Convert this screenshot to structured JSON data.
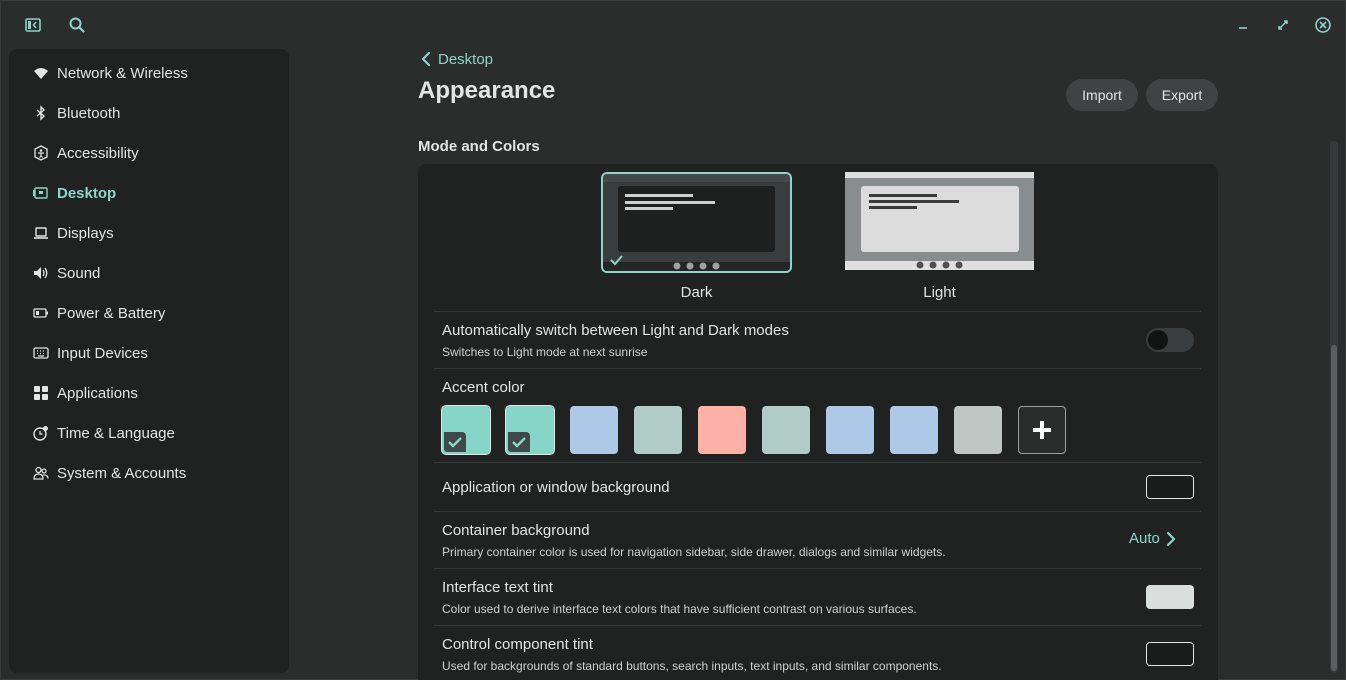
{
  "header": {
    "sidebar_toggle_icon": "sidebar-toggle-icon",
    "search_icon": "search-icon",
    "minimize_icon": "minimize-icon",
    "maximize_icon": "maximize-icon",
    "close_icon": "close-icon"
  },
  "sidebar": {
    "items": [
      {
        "label": "Network & Wireless",
        "icon": "wifi-icon"
      },
      {
        "label": "Bluetooth",
        "icon": "bluetooth-icon"
      },
      {
        "label": "Accessibility",
        "icon": "accessibility-icon"
      },
      {
        "label": "Desktop",
        "icon": "desktop-icon"
      },
      {
        "label": "Displays",
        "icon": "laptop-icon"
      },
      {
        "label": "Sound",
        "icon": "speaker-icon"
      },
      {
        "label": "Power & Battery",
        "icon": "battery-icon"
      },
      {
        "label": "Input Devices",
        "icon": "keyboard-icon"
      },
      {
        "label": "Applications",
        "icon": "apps-grid-icon"
      },
      {
        "label": "Time & Language",
        "icon": "time-language-icon"
      },
      {
        "label": "System & Accounts",
        "icon": "users-icon"
      }
    ],
    "active": "Desktop"
  },
  "page": {
    "breadcrumb": "Desktop",
    "title": "Appearance",
    "import_label": "Import",
    "export_label": "Export",
    "section_title": "Mode and Colors"
  },
  "modes": {
    "dark_label": "Dark",
    "light_label": "Light",
    "selected": "Dark"
  },
  "auto_switch": {
    "title": "Automatically switch between Light and Dark modes",
    "subtitle": "Switches to Light mode at next sunrise",
    "enabled": false
  },
  "accent": {
    "title": "Accent color",
    "colors": [
      "#85d6c9",
      "#85d6c9",
      "#aec8e8",
      "#b1cbc7",
      "#fdb0a6",
      "#b1cbc7",
      "#aec8e8",
      "#aec8e8",
      "#c0c6c3"
    ],
    "add_icon": "plus-icon"
  },
  "window_bg": {
    "title": "Application or window background",
    "color": "#1b1d1d"
  },
  "container_bg": {
    "title": "Container background",
    "subtitle": "Primary container color is used for navigation sidebar, side drawer, dialogs and similar widgets.",
    "value": "Auto"
  },
  "text_tint": {
    "title": "Interface text tint",
    "subtitle": "Color used to derive interface text colors that have sufficient contrast on various surfaces.",
    "color": "#dadedd"
  },
  "control_tint": {
    "title": "Control component tint",
    "subtitle": "Used for backgrounds of standard buttons, search inputs, text inputs, and similar components.",
    "color": "#1b1d1d"
  },
  "colors": {
    "accent": "#8dd4c9",
    "window_bg": "#2b2d2d",
    "container": "#202222"
  }
}
